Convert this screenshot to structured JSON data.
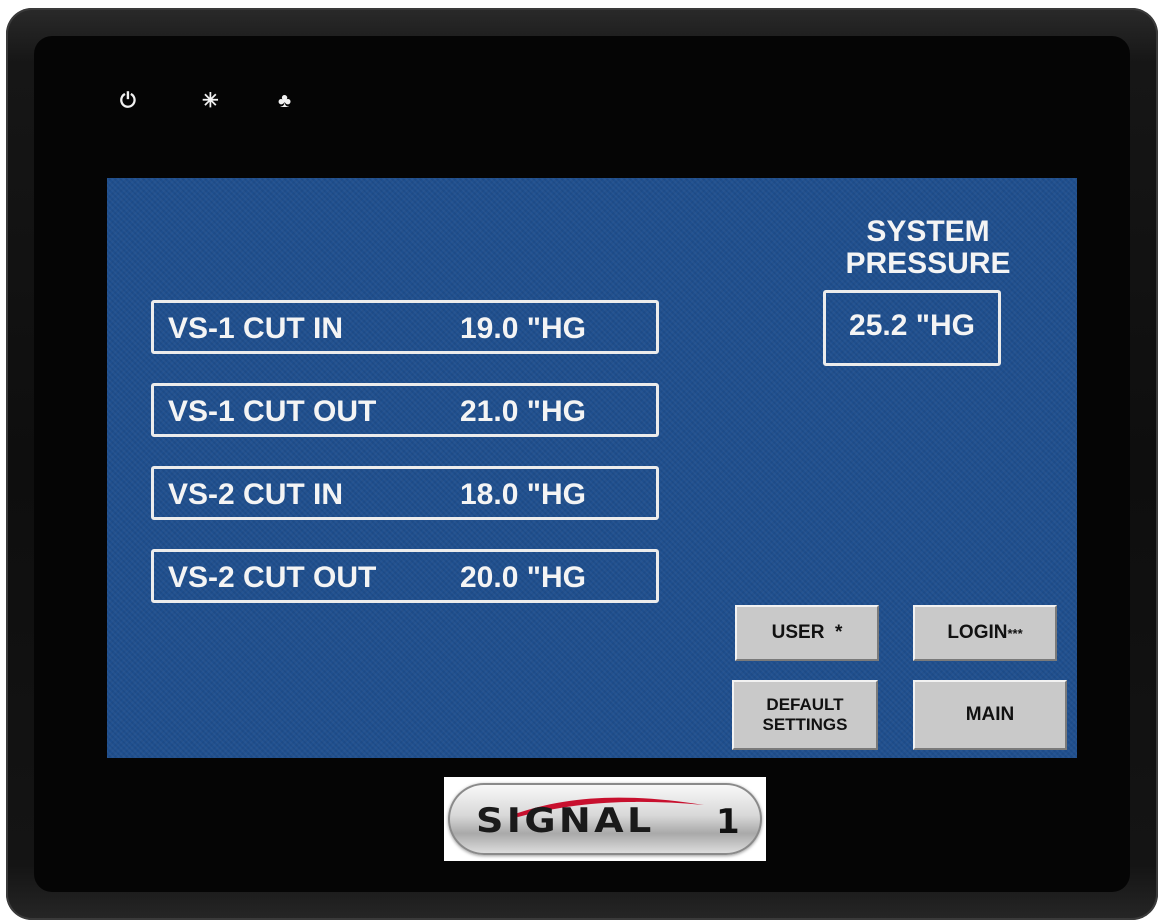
{
  "indicators": [
    {
      "icon": "power-icon",
      "glyph": "⏻"
    },
    {
      "icon": "brightness-icon",
      "glyph": "✳"
    },
    {
      "icon": "network-icon",
      "glyph": "♣"
    }
  ],
  "setpoints": [
    {
      "label": "VS-1 CUT IN",
      "value": "19.0 \"HG"
    },
    {
      "label": "VS-1 CUT OUT",
      "value": "21.0 \"HG"
    },
    {
      "label": "VS-2 CUT IN",
      "value": "18.0 \"HG"
    },
    {
      "label": "VS-2 CUT OUT",
      "value": "20.0 \"HG"
    }
  ],
  "system_pressure": {
    "title_line1": "SYSTEM",
    "title_line2": "PRESSURE",
    "value": "25.2 \"HG"
  },
  "buttons": {
    "user": "USER  *",
    "login": "LOGIN",
    "login_stars": "***",
    "default_line1": "DEFAULT",
    "default_line2": "SETTINGS",
    "main": "MAIN"
  },
  "logo": {
    "text": "SIGNAL",
    "number": "1"
  },
  "colors": {
    "screen": "#1f4f8e",
    "button": "#c9c9c9",
    "text": "#f4f4f4",
    "swoosh": "#c8102e"
  }
}
